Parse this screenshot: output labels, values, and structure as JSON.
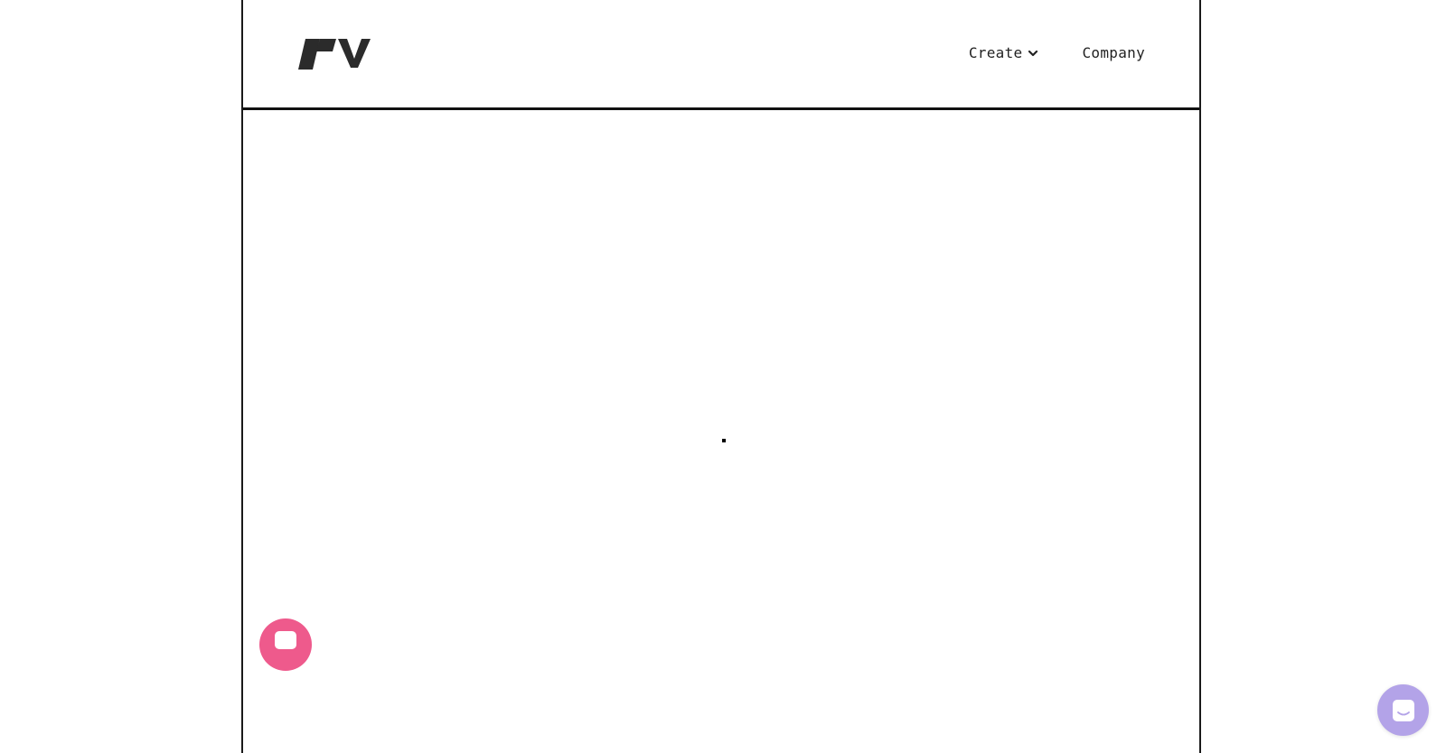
{
  "brand": {
    "logo_icon": "brand-logo-icon",
    "color": "#2b2b2b"
  },
  "nav": {
    "items": [
      {
        "label": "Create",
        "has_dropdown": true,
        "icon": "chevron-down-icon"
      },
      {
        "label": "Company",
        "has_dropdown": false
      }
    ]
  },
  "main": {
    "state": "loading",
    "loader_icon": "loading-indicator"
  },
  "widgets": {
    "feedback_button": {
      "icon": "message-icon",
      "color": "#ee5a8c"
    },
    "chat_launcher": {
      "icon": "chat-bubble-icon",
      "color": "#b3a3e8"
    }
  }
}
